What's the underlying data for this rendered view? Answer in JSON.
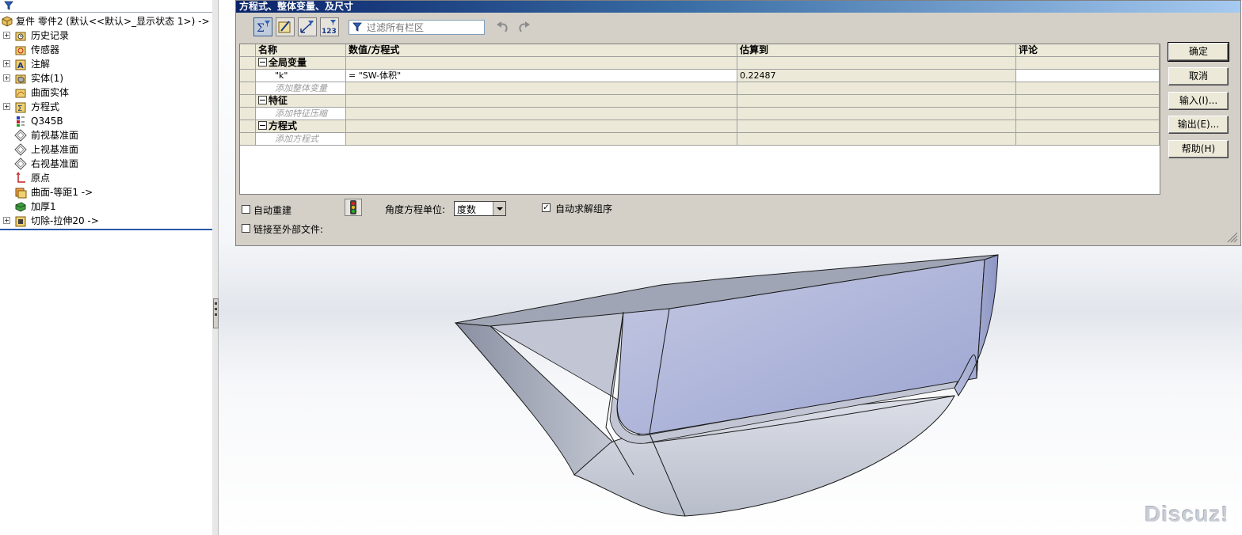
{
  "tree": {
    "root_label": "复件 零件2  (默认<<默认>_显示状态 1>) ->",
    "items": [
      {
        "label": "历史记录",
        "icon": "history-folder-icon",
        "expand": true
      },
      {
        "label": "传感器",
        "icon": "sensor-icon",
        "expand": false
      },
      {
        "label": "注解",
        "icon": "annotation-icon",
        "expand": true
      },
      {
        "label": "实体(1)",
        "icon": "solid-bodies-icon",
        "expand": true
      },
      {
        "label": "曲面实体",
        "icon": "surface-bodies-icon",
        "expand": false
      },
      {
        "label": "方程式",
        "icon": "equations-icon",
        "expand": true
      },
      {
        "label": "Q345B",
        "icon": "material-icon",
        "expand": false
      },
      {
        "label": "前视基准面",
        "icon": "plane-icon",
        "expand": false
      },
      {
        "label": "上视基准面",
        "icon": "plane-icon",
        "expand": false
      },
      {
        "label": "右视基准面",
        "icon": "plane-icon",
        "expand": false
      },
      {
        "label": "原点",
        "icon": "origin-icon",
        "expand": false
      },
      {
        "label": "曲面-等距1 ->",
        "icon": "surface-offset-icon",
        "expand": false
      },
      {
        "label": "加厚1",
        "icon": "thicken-icon",
        "expand": false
      },
      {
        "label": "切除-拉伸20 ->",
        "icon": "cut-extrude-icon",
        "expand": true
      }
    ]
  },
  "dialog": {
    "title": "方程式、整体变量、及尺寸",
    "filter_placeholder": "过滤所有栏区",
    "columns": [
      "名称",
      "数值/方程式",
      "估算到",
      "评论"
    ],
    "sections": [
      {
        "title": "全局变量",
        "rows": [
          {
            "name": "\"k\"",
            "value": "= \"SW-体积\"",
            "evaluates": "0.22487",
            "comment": ""
          }
        ],
        "add_label": "添加整体变量"
      },
      {
        "title": "特征",
        "rows": [],
        "add_label": "添加特征压缩"
      },
      {
        "title": "方程式",
        "rows": [],
        "add_label": "添加方程式"
      }
    ],
    "buttons": {
      "ok": "确定",
      "cancel": "取消",
      "import": "输入(I)...",
      "export": "输出(E)...",
      "help": "帮助(H)"
    },
    "auto_rebuild": {
      "label": "自动重建",
      "checked": false
    },
    "angle_unit_label": "角度方程单位:",
    "angle_unit_value": "度数",
    "auto_solve": {
      "label": "自动求解组序",
      "checked": true
    },
    "link_external": {
      "label": "链接至外部文件:",
      "checked": false
    }
  },
  "watermark": "Discuz!",
  "colors": {
    "titlebar_start": "#0a246a",
    "titlebar_end": "#a6caf0",
    "dialog_bg": "#d4d0c8",
    "model_face": "#aab2d8",
    "model_side": "#c8ccd6"
  }
}
